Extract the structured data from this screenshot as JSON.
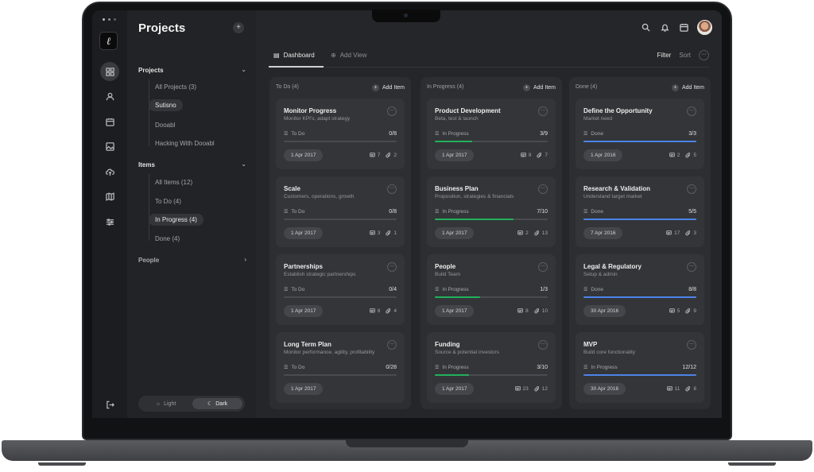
{
  "sidebar_panel": {
    "title": "Projects",
    "projects_section": "Projects",
    "projects": [
      "All Projects (3)",
      "Sutisno",
      "Dooabl",
      "Hacking With Dooabl"
    ],
    "items_section": "Items",
    "items": [
      "All Items (12)",
      "To Do (4)",
      "In Progress (4)",
      "Done (4)"
    ],
    "people_section": "People",
    "theme_light": "Light",
    "theme_dark": "Dark"
  },
  "rail_icons": [
    "dashboard-icon",
    "user-icon",
    "calendar-icon",
    "image-icon",
    "cloud-upload-icon",
    "map-icon",
    "sliders-icon",
    "logout-icon"
  ],
  "toolbar": {
    "tab_dashboard": "Dashboard",
    "tab_add_view": "Add View",
    "filter": "Filter",
    "sort": "Sort",
    "more": "···"
  },
  "board": {
    "add_item_label": "Add Item",
    "columns": [
      {
        "title": "To Do (4)",
        "color": "#4a4b50",
        "cards": [
          {
            "title": "Monitor Progress",
            "subtitle": "Monitor KPI's, adapt strategy",
            "status": "To Do",
            "count": "0/8",
            "progress": 0,
            "date": "1 Apr 2017",
            "comments": "7",
            "attachments": "2"
          },
          {
            "title": "Scale",
            "subtitle": "Customers, operations,  growth",
            "status": "To Do",
            "count": "0/8",
            "progress": 0,
            "date": "1 Apr 2017",
            "comments": "3",
            "attachments": "1"
          },
          {
            "title": "Partnerships",
            "subtitle": "Establish strategic partnerships",
            "status": "To Do",
            "count": "0/4",
            "progress": 0,
            "date": "1 Apr 2017",
            "comments": "6",
            "attachments": "4"
          },
          {
            "title": "Long Term Plan",
            "subtitle": "Monitor performance, agility, profitability",
            "status": "To Do",
            "count": "0/28",
            "progress": 0,
            "date": "1 Apr 2017",
            "comments": "",
            "attachments": ""
          }
        ]
      },
      {
        "title": "In Progress (4)",
        "color": "#22b15b",
        "cards": [
          {
            "title": "Product Development",
            "subtitle": "Beta, test & launch",
            "status": "In Progress",
            "count": "3/9",
            "progress": 0.333,
            "date": "1 Apr 2017",
            "comments": "9",
            "attachments": "7"
          },
          {
            "title": "Business Plan",
            "subtitle": "Proposition, strategies & financials",
            "status": "In Progress",
            "count": "7/10",
            "progress": 0.7,
            "date": "1 Apr 2017",
            "comments": "2",
            "attachments": "13"
          },
          {
            "title": "People",
            "subtitle": "Build Team",
            "status": "In Progress",
            "count": "1/3",
            "progress": 0.4,
            "date": "1 Apr 2017",
            "comments": "8",
            "attachments": "10"
          },
          {
            "title": "Funding",
            "subtitle": "Source & potential investors",
            "status": "In Progress",
            "count": "3/10",
            "progress": 0.3,
            "date": "1 Apr 2017",
            "comments": "23",
            "attachments": "12"
          }
        ]
      },
      {
        "title": "Done (4)",
        "color": "#4b84e8",
        "cards": [
          {
            "title": "Define the Opportunity",
            "subtitle": "Market need",
            "status": "Done",
            "count": "3/3",
            "progress": 1,
            "date": "1 Apr 2016",
            "comments": "2",
            "attachments": "5"
          },
          {
            "title": "Research & Validation",
            "subtitle": "Understand target market",
            "status": "Done",
            "count": "5/5",
            "progress": 1,
            "date": "7 Apr 2016",
            "comments": "17",
            "attachments": "3"
          },
          {
            "title": "Legal & Regulatory",
            "subtitle": "Setup & admin",
            "status": "Done",
            "count": "8/8",
            "progress": 1,
            "date": "30 Apr 2016",
            "comments": "5",
            "attachments": "9"
          },
          {
            "title": "MVP",
            "subtitle": "Build core functionality",
            "status": "In Progress",
            "count": "12/12",
            "progress": 1,
            "date": "30 Apr 2016",
            "comments": "11",
            "attachments": "8"
          }
        ]
      }
    ]
  }
}
